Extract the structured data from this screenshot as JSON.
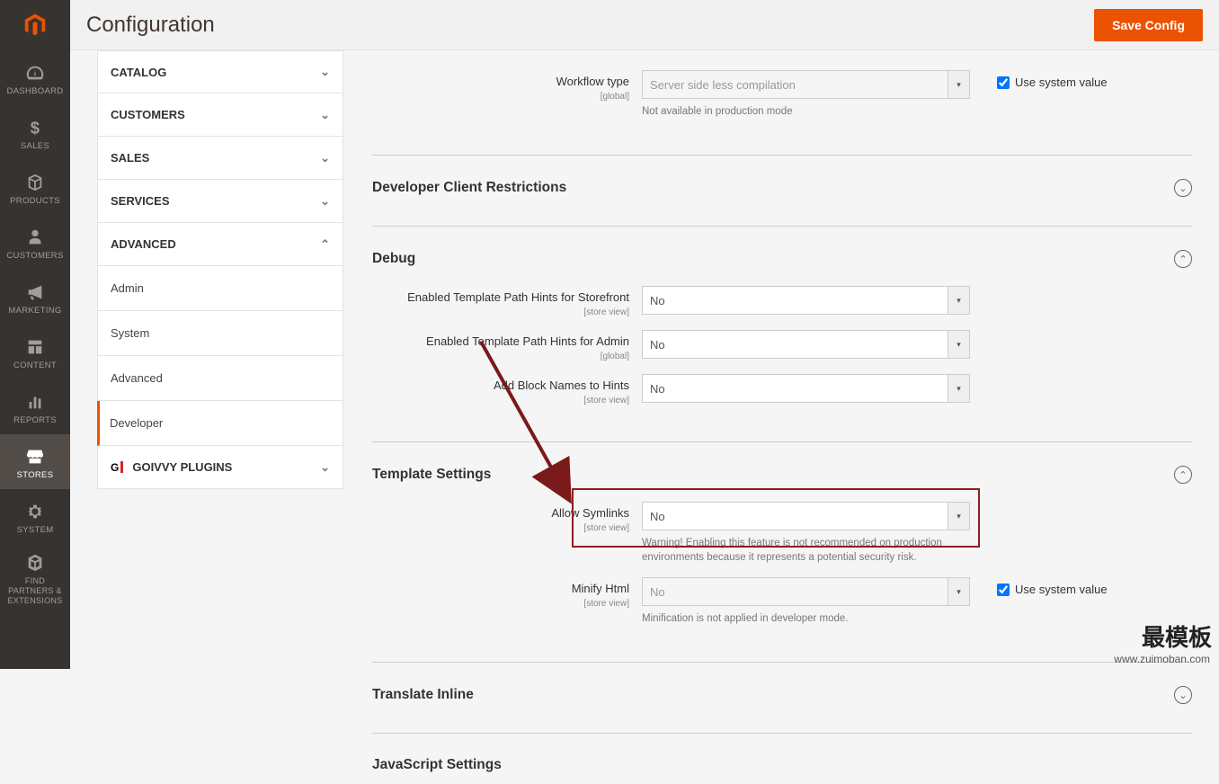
{
  "header": {
    "title": "Configuration",
    "save_label": "Save Config"
  },
  "leftnav": {
    "items": [
      {
        "label": "DASHBOARD"
      },
      {
        "label": "SALES"
      },
      {
        "label": "PRODUCTS"
      },
      {
        "label": "CUSTOMERS"
      },
      {
        "label": "MARKETING"
      },
      {
        "label": "CONTENT"
      },
      {
        "label": "REPORTS"
      },
      {
        "label": "STORES"
      },
      {
        "label": "SYSTEM"
      },
      {
        "label": "FIND PARTNERS & EXTENSIONS"
      }
    ]
  },
  "sidebar": {
    "catalog": "CATALOG",
    "customers": "CUSTOMERS",
    "sales": "SALES",
    "services": "SERVICES",
    "advanced": "ADVANCED",
    "adv_items": {
      "admin": "Admin",
      "system": "System",
      "advanced2": "Advanced",
      "developer": "Developer"
    },
    "goivvy": "GOIVVY PLUGINS"
  },
  "sections": {
    "workflow": {
      "label": "Workflow type",
      "scope": "[global]",
      "value": "Server side less compilation",
      "note": "Not available in production mode",
      "checkbox": "Use system value"
    },
    "dev_restrict_title": "Developer Client Restrictions",
    "debug_title": "Debug",
    "debug": {
      "tpl_store_label": "Enabled Template Path Hints for Storefront",
      "tpl_store_scope": "[store view]",
      "tpl_store_value": "No",
      "tpl_admin_label": "Enabled Template Path Hints for Admin",
      "tpl_admin_scope": "[global]",
      "tpl_admin_value": "No",
      "block_label": "Add Block Names to Hints",
      "block_scope": "[store view]",
      "block_value": "No"
    },
    "tmpl_title": "Template Settings",
    "tmpl": {
      "symlinks_label": "Allow Symlinks",
      "symlinks_scope": "[store view]",
      "symlinks_value": "No",
      "symlinks_note": "Warning! Enabling this feature is not recommended on production environments because it represents a potential security risk.",
      "minify_label": "Minify Html",
      "minify_scope": "[store view]",
      "minify_value": "No",
      "minify_note": "Minification is not applied in developer mode.",
      "minify_checkbox": "Use system value"
    },
    "translate_title": "Translate Inline",
    "js_title": "JavaScript Settings"
  },
  "watermark": {
    "cn": "最模板",
    "url": "www.zuimoban.com"
  }
}
